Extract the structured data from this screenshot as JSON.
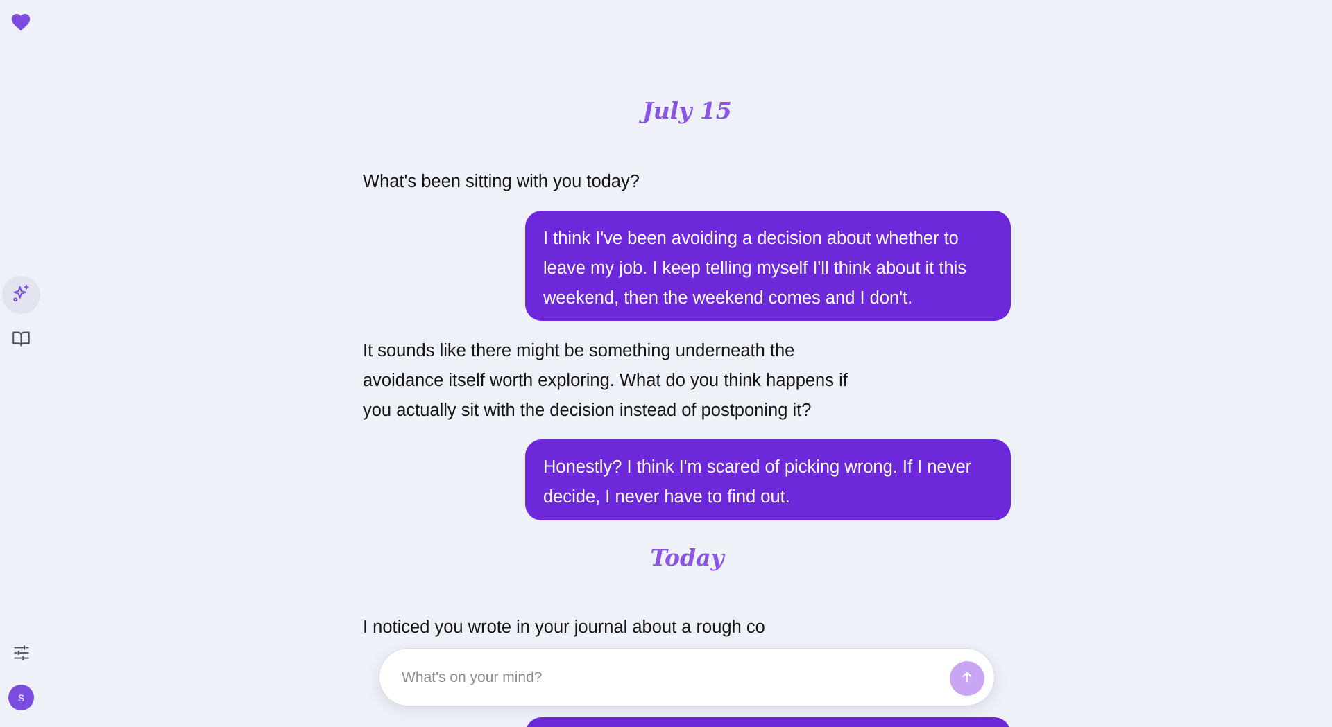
{
  "sidebar": {
    "logo_icon": "heart-icon",
    "nav": [
      {
        "name": "chat",
        "icon": "sparkle-icon",
        "active": true
      },
      {
        "name": "journal",
        "icon": "book-open-icon",
        "active": false
      },
      {
        "name": "settings",
        "icon": "sliders-icon",
        "active": false
      }
    ],
    "avatar_initial": "S"
  },
  "conversation": {
    "sections": [
      {
        "date": "July 15",
        "messages": [
          {
            "role": "assistant",
            "text": "What's been sitting with you today?"
          },
          {
            "role": "user",
            "text": "I think I've been avoiding a decision about whether to leave my job. I keep telling myself I'll think about it this weekend, then the weekend comes and I don't."
          },
          {
            "role": "assistant",
            "text": "It sounds like there might be something underneath the avoidance itself worth exploring. What do you think happens if you actually sit with the decision instead of postponing it?"
          },
          {
            "role": "user",
            "text": "Honestly? I think I'm scared of picking wrong. If I never decide, I never have to find out."
          }
        ]
      },
      {
        "date": "Today",
        "messages": [
          {
            "role": "assistant",
            "text": "I noticed you wrote in your journal about a rough co"
          },
          {
            "role": "user",
            "text": ""
          }
        ]
      }
    ]
  },
  "composer": {
    "placeholder": "What's on your mind?",
    "value": "",
    "send_icon": "arrow-up-icon"
  },
  "colors": {
    "background": "#eef1f8",
    "accent": "#6d28d9",
    "heading": "#8a55e3",
    "send_button": "#c9a6f3",
    "avatar": "#7c4cdf"
  }
}
